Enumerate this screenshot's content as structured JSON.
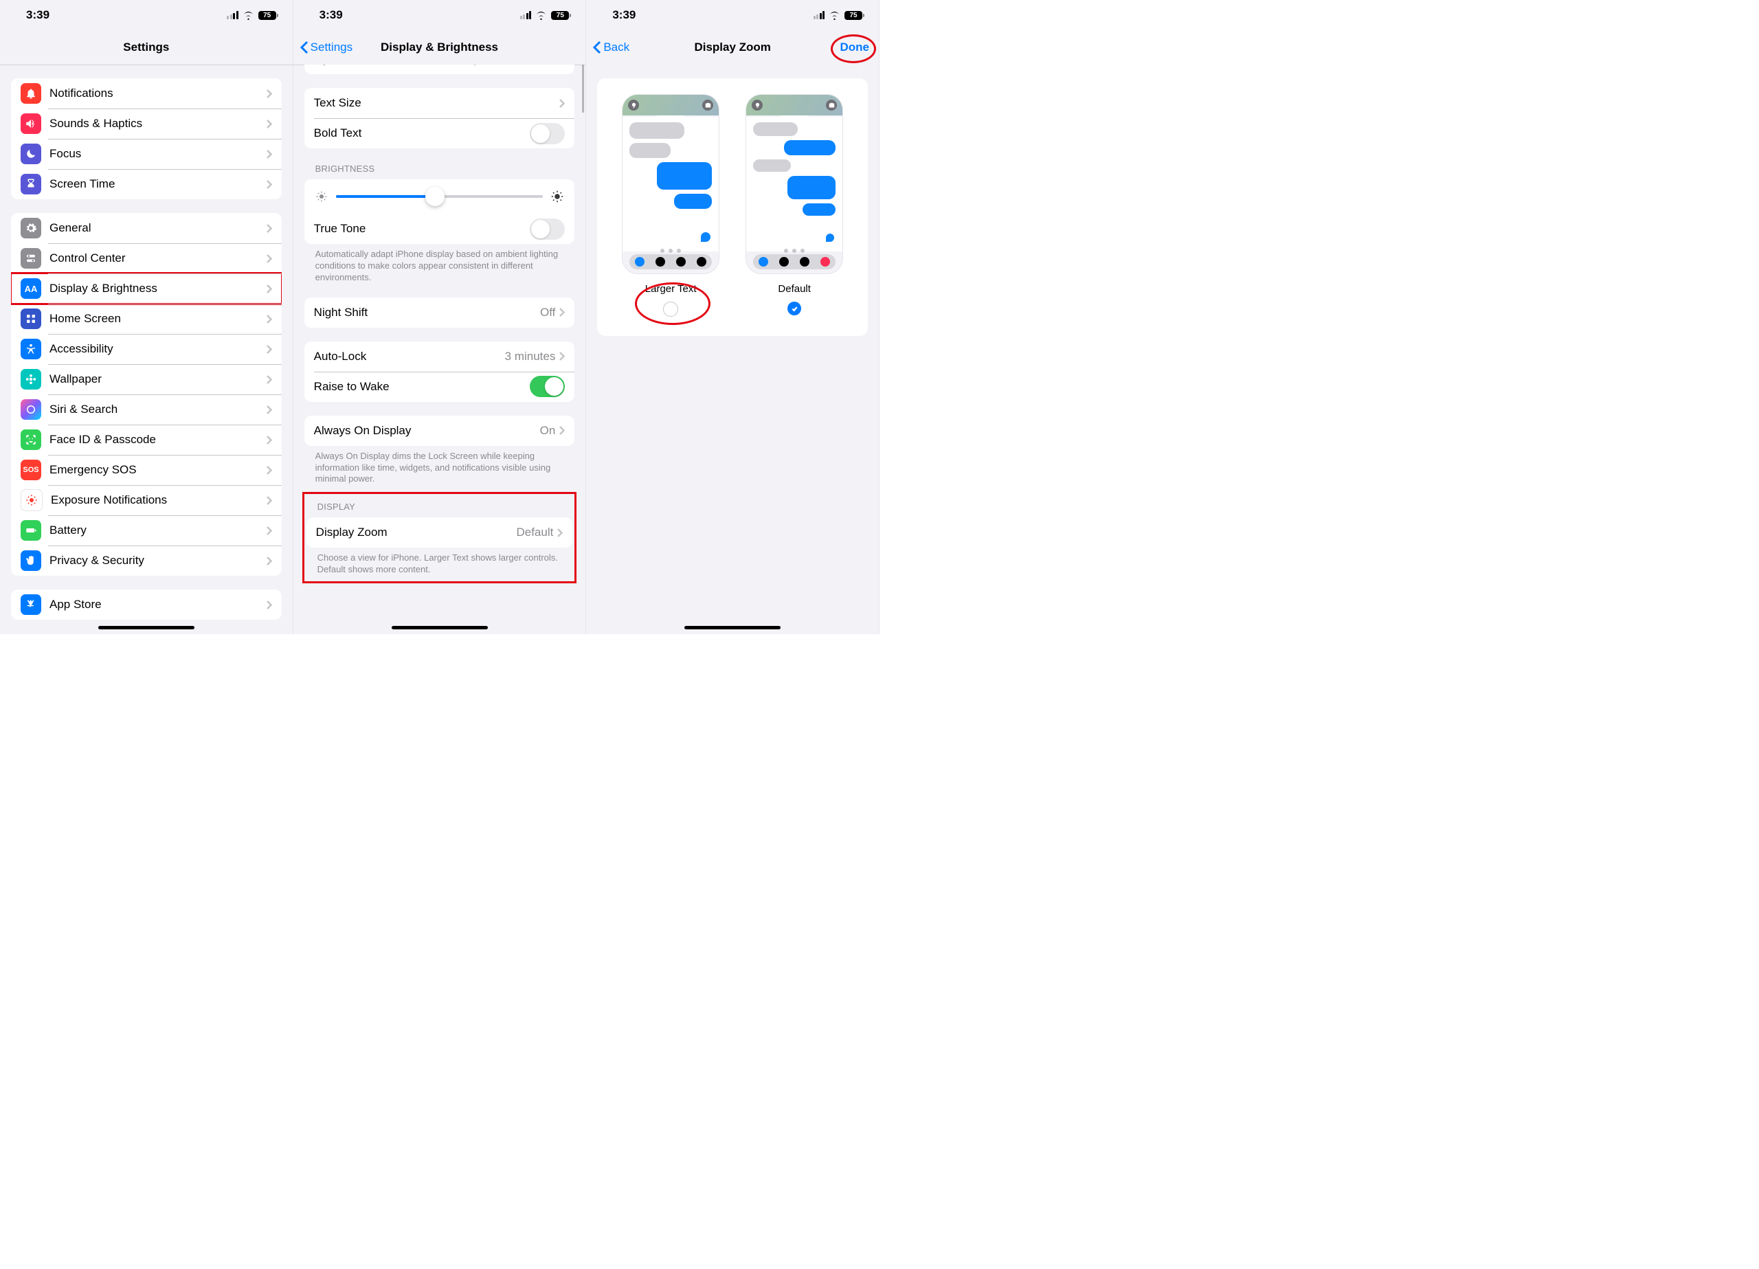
{
  "status": {
    "time": "3:39",
    "battery": "75"
  },
  "pane1": {
    "title": "Settings",
    "group1": [
      {
        "label": "Notifications",
        "bg": "#ff3b30"
      },
      {
        "label": "Sounds & Haptics",
        "bg": "#ff2d55"
      },
      {
        "label": "Focus",
        "bg": "#5856d6"
      },
      {
        "label": "Screen Time",
        "bg": "#5856d6"
      }
    ],
    "group2": [
      {
        "label": "General",
        "bg": "#8e8e93"
      },
      {
        "label": "Control Center",
        "bg": "#8e8e93"
      },
      {
        "label": "Display & Brightness",
        "bg": "#007aff"
      },
      {
        "label": "Home Screen",
        "bg": "#3355c9"
      },
      {
        "label": "Accessibility",
        "bg": "#007aff"
      },
      {
        "label": "Wallpaper",
        "bg": "#00c7be"
      },
      {
        "label": "Siri & Search",
        "bg": "#1c1c1e"
      },
      {
        "label": "Face ID & Passcode",
        "bg": "#30d158"
      },
      {
        "label": "Emergency SOS",
        "bg": "#ff3b30"
      },
      {
        "label": "Exposure Notifications",
        "bg": "#ffffff"
      },
      {
        "label": "Battery",
        "bg": "#30d158"
      },
      {
        "label": "Privacy & Security",
        "bg": "#007aff"
      }
    ],
    "group3": [
      {
        "label": "App Store",
        "bg": "#007aff"
      }
    ]
  },
  "pane2": {
    "back": "Settings",
    "title": "Display & Brightness",
    "topRowLabel": "Options",
    "topRowValue": "Light Until Sunset",
    "text": {
      "textSize": "Text Size",
      "boldText": "Bold Text"
    },
    "brightness": {
      "header": "BRIGHTNESS",
      "trueTone": "True Tone",
      "footer": "Automatically adapt iPhone display based on ambient lighting conditions to make colors appear consistent in different environments."
    },
    "nightShift": {
      "label": "Night Shift",
      "value": "Off"
    },
    "autoLock": {
      "label": "Auto-Lock",
      "value": "3 minutes",
      "raise": "Raise to Wake"
    },
    "aod": {
      "label": "Always On Display",
      "value": "On",
      "footer": "Always On Display dims the Lock Screen while keeping information like time, widgets, and notifications visible using minimal power."
    },
    "display": {
      "header": "DISPLAY",
      "zoom": "Display Zoom",
      "value": "Default",
      "footer": "Choose a view for iPhone. Larger Text shows larger controls. Default shows more content."
    }
  },
  "pane3": {
    "back": "Back",
    "title": "Display Zoom",
    "done": "Done",
    "options": {
      "larger": "Larger Text",
      "default": "Default"
    }
  }
}
